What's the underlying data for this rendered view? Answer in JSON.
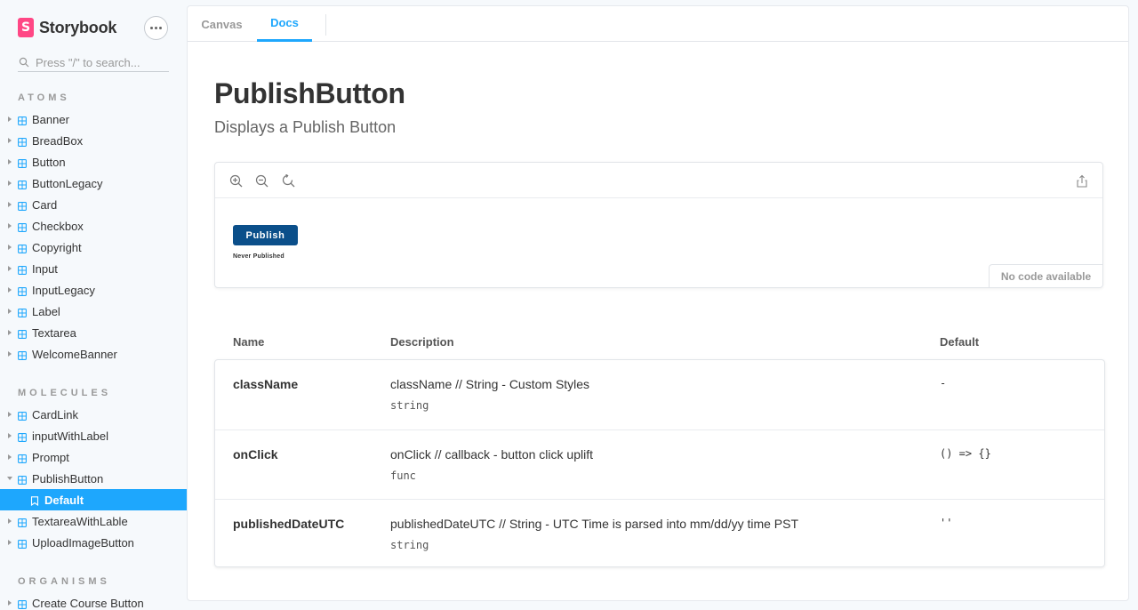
{
  "brand": {
    "name": "Storybook",
    "logo_letter": "S"
  },
  "search": {
    "placeholder": "Press \"/\" to search..."
  },
  "sidebar": {
    "sections": [
      {
        "title": "ATOMS"
      },
      {
        "title": "MOLECULES"
      },
      {
        "title": "ORGANISMS"
      }
    ],
    "atoms": [
      "Banner",
      "BreadBox",
      "Button",
      "ButtonLegacy",
      "Card",
      "Checkbox",
      "Copyright",
      "Input",
      "InputLegacy",
      "Label",
      "Textarea",
      "WelcomeBanner"
    ],
    "molecules": [
      "CardLink",
      "inputWithLabel",
      "Prompt",
      "PublishButton"
    ],
    "selected_story": "Default",
    "molecules_after": [
      "TextareaWithLable",
      "UploadImageButton"
    ],
    "organisms": [
      "Create Course Button"
    ]
  },
  "tabs": [
    {
      "label": "Canvas",
      "active": false
    },
    {
      "label": "Docs",
      "active": true
    }
  ],
  "doc": {
    "title": "PublishButton",
    "subtitle": "Displays a Publish Button"
  },
  "preview": {
    "button_label": "Publish",
    "status_text": "Never Published",
    "no_code_label": "No code available"
  },
  "props": {
    "headers": {
      "name": "Name",
      "description": "Description",
      "default": "Default"
    },
    "rows": [
      {
        "name": "className",
        "description": "className // String - Custom Styles",
        "type": "string",
        "default": "-"
      },
      {
        "name": "onClick",
        "description": "onClick // callback - button click uplift",
        "type": "func",
        "default": "() => {}"
      },
      {
        "name": "publishedDateUTC",
        "description": "publishedDateUTC // String - UTC Time is parsed into mm/dd/yy time PST",
        "type": "string",
        "default": "''"
      }
    ]
  },
  "colors": {
    "accent": "#1ea7fd",
    "brand": "#ff4785",
    "publish_button": "#0b4f8a"
  }
}
